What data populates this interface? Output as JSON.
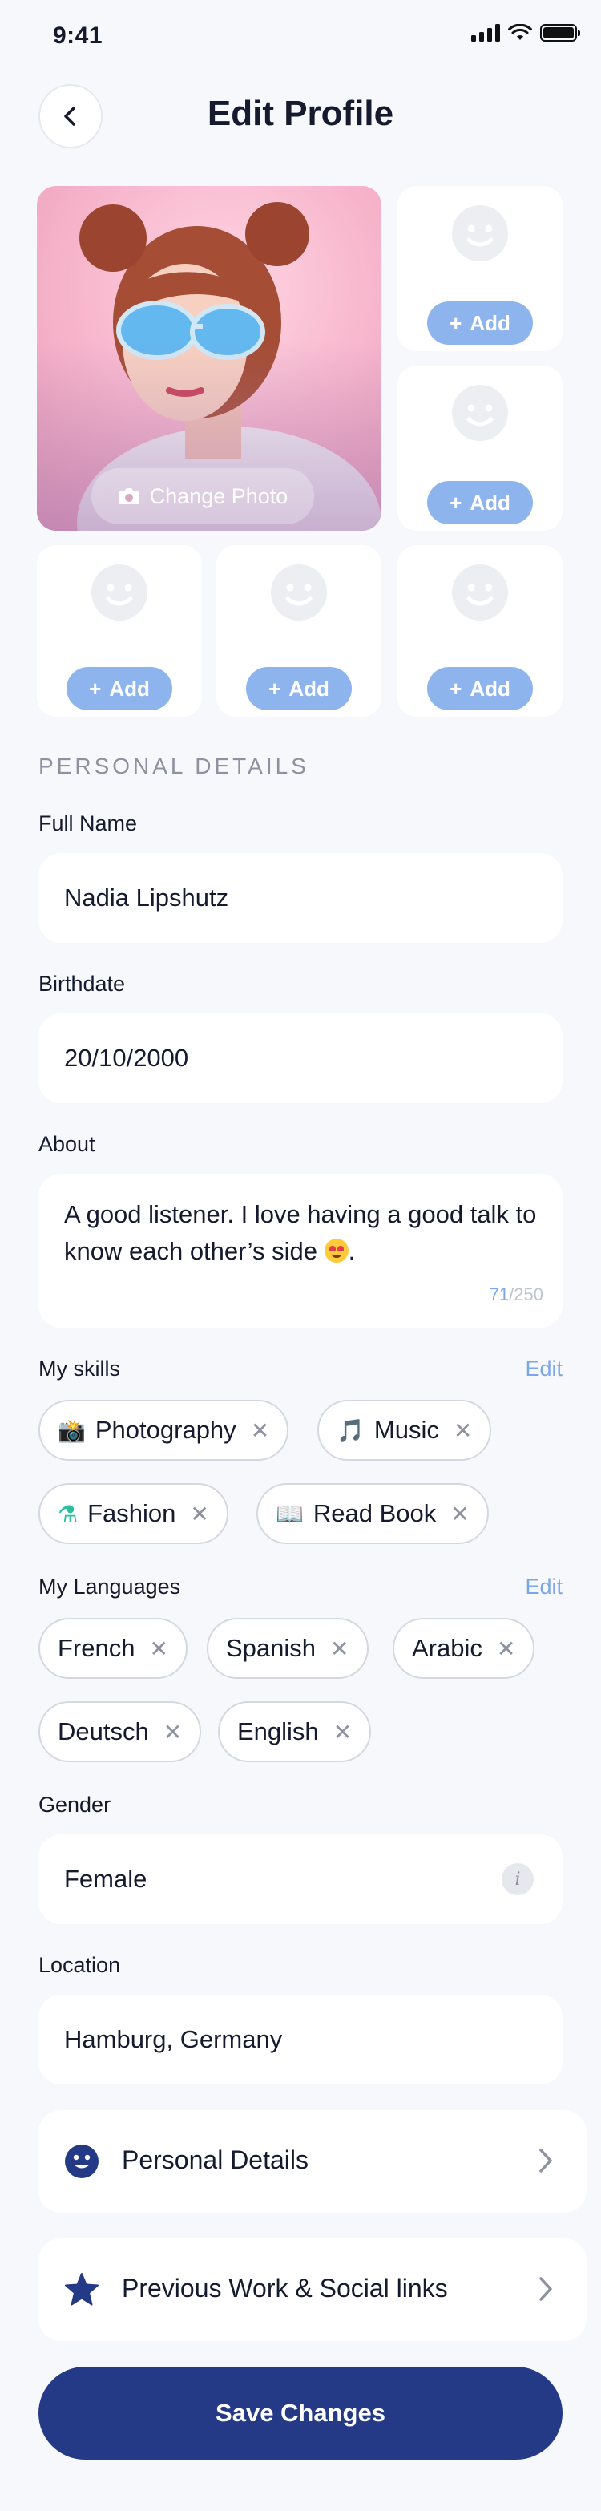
{
  "status_bar": {
    "time": "9:41"
  },
  "header": {
    "title": "Edit Profile"
  },
  "photos": {
    "change_photo_label": "Change Photo",
    "add_label": "Add"
  },
  "section_title": "PERSONAL DETAILS",
  "full_name": {
    "label": "Full Name",
    "value": "Nadia Lipshutz"
  },
  "birthdate": {
    "label": "Birthdate",
    "value": "20/10/2000"
  },
  "about": {
    "label": "About",
    "value": "A good listener. I love having a good talk to know each other’s side",
    "count": "71",
    "max": "/250"
  },
  "skills": {
    "label": "My skills",
    "edit_label": "Edit",
    "items": [
      {
        "emoji": "📸",
        "label": "Photography"
      },
      {
        "emoji": "🎵",
        "label": "Music"
      },
      {
        "emoji": "⚗",
        "label": "Fashion"
      },
      {
        "emoji": "📖",
        "label": "Read Book"
      }
    ]
  },
  "languages": {
    "label": "My Languages",
    "edit_label": "Edit",
    "items": [
      "French",
      "Spanish",
      "Arabic",
      "Deutsch",
      "English"
    ]
  },
  "gender": {
    "label": "Gender",
    "value": "Female",
    "info_icon": "i"
  },
  "location": {
    "label": "Location",
    "value": "Hamburg, Germany"
  },
  "nav": {
    "personal_details": "Personal Details",
    "previous_work": "Previous Work & Social links"
  },
  "save_label": "Save Changes",
  "colors": {
    "primary": "#243a86",
    "accent": "#8eb4ee",
    "link": "#7ca7e6"
  }
}
